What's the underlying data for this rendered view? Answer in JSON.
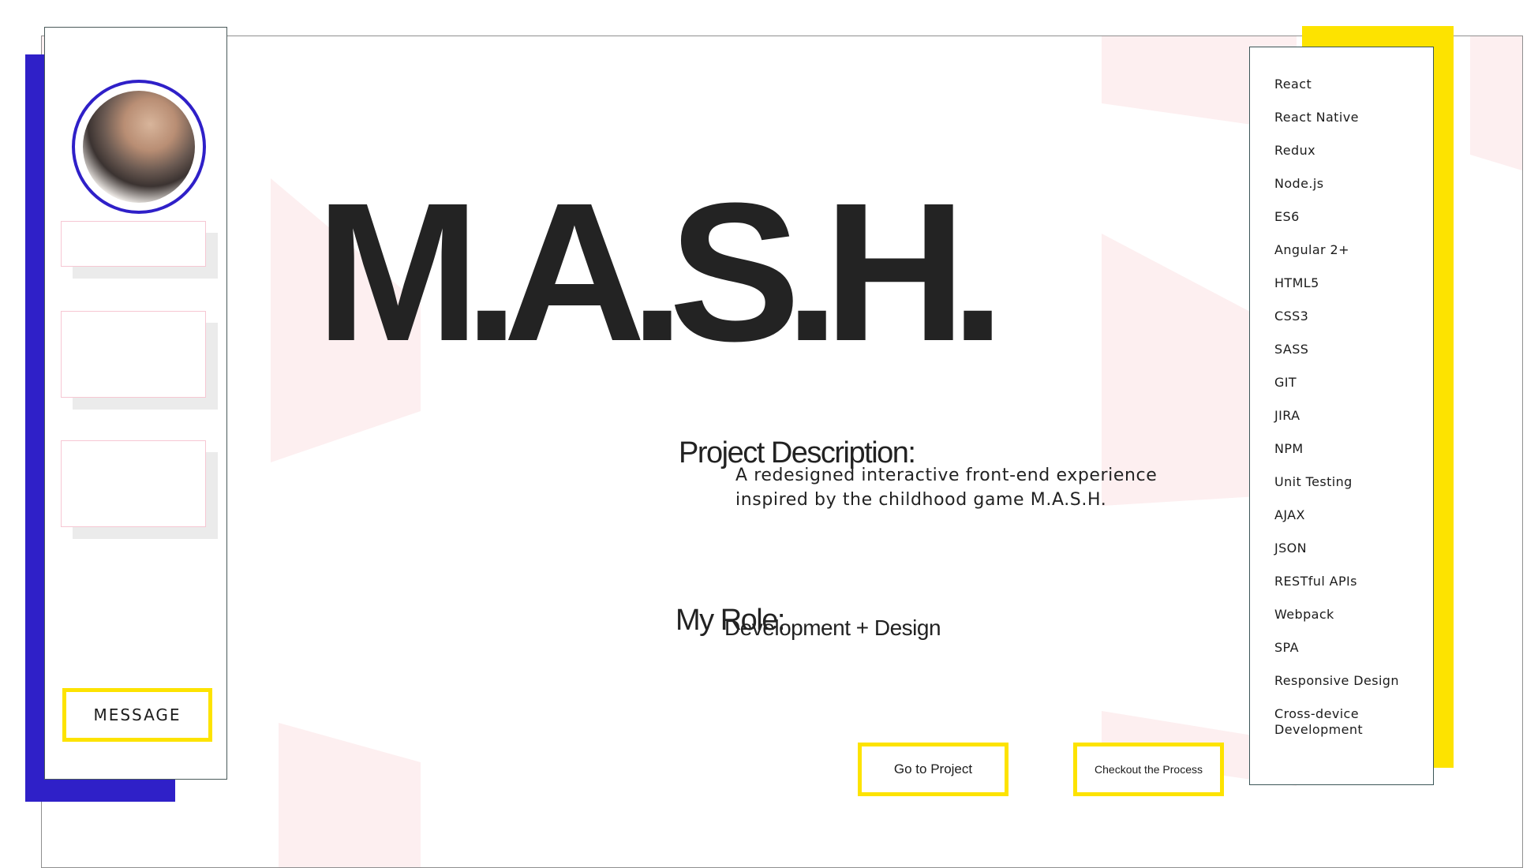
{
  "profile": {
    "avatar_icon": "profile-photo",
    "message_label": "MESSAGE"
  },
  "project": {
    "title": "M.A.S.H.",
    "description_heading": "Project Description:",
    "description": "A redesigned interactive front-end experience inspired by the childhood game M.A.S.H.",
    "role_heading": "My Role:",
    "role": "Development + Design",
    "go_to_project_label": "Go to Project",
    "process_label": "Checkout the Process"
  },
  "skills": [
    "React",
    "React Native",
    "Redux",
    "Node.js",
    "ES6",
    "Angular 2+",
    "HTML5",
    "CSS3",
    "SASS",
    "GIT",
    "JIRA",
    "NPM",
    "Unit Testing",
    "AJAX",
    "JSON",
    "RESTful APIs",
    "Webpack",
    "SPA",
    "Responsive Design",
    "Cross-device Development"
  ],
  "colors": {
    "accent_blue": "#2f20c8",
    "accent_yellow": "#fde300",
    "pink_tint": "#fdeff0",
    "text": "#232323"
  }
}
